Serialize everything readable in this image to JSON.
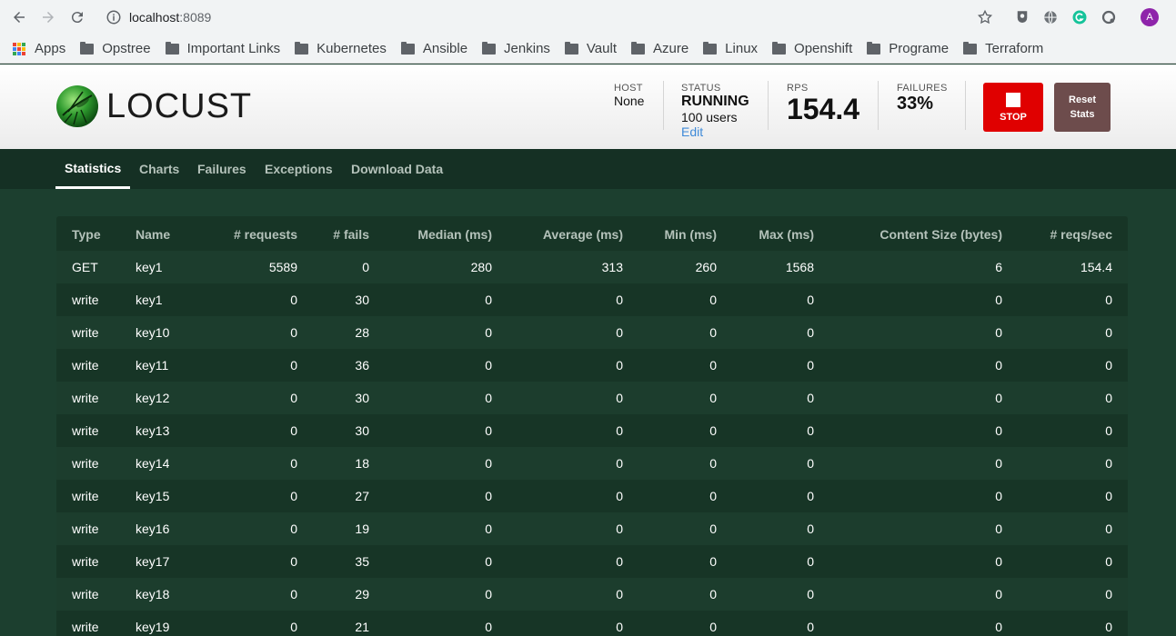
{
  "browser": {
    "url_host": "localhost",
    "url_port": ":8089"
  },
  "bookmarks": {
    "apps_label": "Apps",
    "items": [
      "Opstree",
      "Important Links",
      "Kubernetes",
      "Ansible",
      "Jenkins",
      "Vault",
      "Azure",
      "Linux",
      "Openshift",
      "Programe",
      "Terraform"
    ]
  },
  "header": {
    "logo_text": "LOCUST",
    "host_label": "HOST",
    "host_value": "None",
    "status_label": "STATUS",
    "status_value": "RUNNING",
    "users_text": "100 users",
    "edit_label": "Edit",
    "rps_label": "RPS",
    "rps_value": "154.4",
    "failures_label": "FAILURES",
    "failures_value": "33%",
    "stop_label": "STOP",
    "reset_label_line1": "Reset",
    "reset_label_line2": "Stats"
  },
  "tabs": [
    "Statistics",
    "Charts",
    "Failures",
    "Exceptions",
    "Download Data"
  ],
  "table": {
    "columns": [
      "Type",
      "Name",
      "# requests",
      "# fails",
      "Median (ms)",
      "Average (ms)",
      "Min (ms)",
      "Max (ms)",
      "Content Size (bytes)",
      "# reqs/sec"
    ],
    "rows": [
      [
        "GET",
        "key1",
        "5589",
        "0",
        "280",
        "313",
        "260",
        "1568",
        "6",
        "154.4"
      ],
      [
        "write",
        "key1",
        "0",
        "30",
        "0",
        "0",
        "0",
        "0",
        "0",
        "0"
      ],
      [
        "write",
        "key10",
        "0",
        "28",
        "0",
        "0",
        "0",
        "0",
        "0",
        "0"
      ],
      [
        "write",
        "key11",
        "0",
        "36",
        "0",
        "0",
        "0",
        "0",
        "0",
        "0"
      ],
      [
        "write",
        "key12",
        "0",
        "30",
        "0",
        "0",
        "0",
        "0",
        "0",
        "0"
      ],
      [
        "write",
        "key13",
        "0",
        "30",
        "0",
        "0",
        "0",
        "0",
        "0",
        "0"
      ],
      [
        "write",
        "key14",
        "0",
        "18",
        "0",
        "0",
        "0",
        "0",
        "0",
        "0"
      ],
      [
        "write",
        "key15",
        "0",
        "27",
        "0",
        "0",
        "0",
        "0",
        "0",
        "0"
      ],
      [
        "write",
        "key16",
        "0",
        "19",
        "0",
        "0",
        "0",
        "0",
        "0",
        "0"
      ],
      [
        "write",
        "key17",
        "0",
        "35",
        "0",
        "0",
        "0",
        "0",
        "0",
        "0"
      ],
      [
        "write",
        "key18",
        "0",
        "29",
        "0",
        "0",
        "0",
        "0",
        "0",
        "0"
      ],
      [
        "write",
        "key19",
        "0",
        "21",
        "0",
        "0",
        "0",
        "0",
        "0",
        "0"
      ]
    ]
  },
  "colors": {
    "stop": "#e00000",
    "reset": "#6d4c4c",
    "page_bg": "#1c3f2f",
    "tabs_bg": "#153024"
  }
}
